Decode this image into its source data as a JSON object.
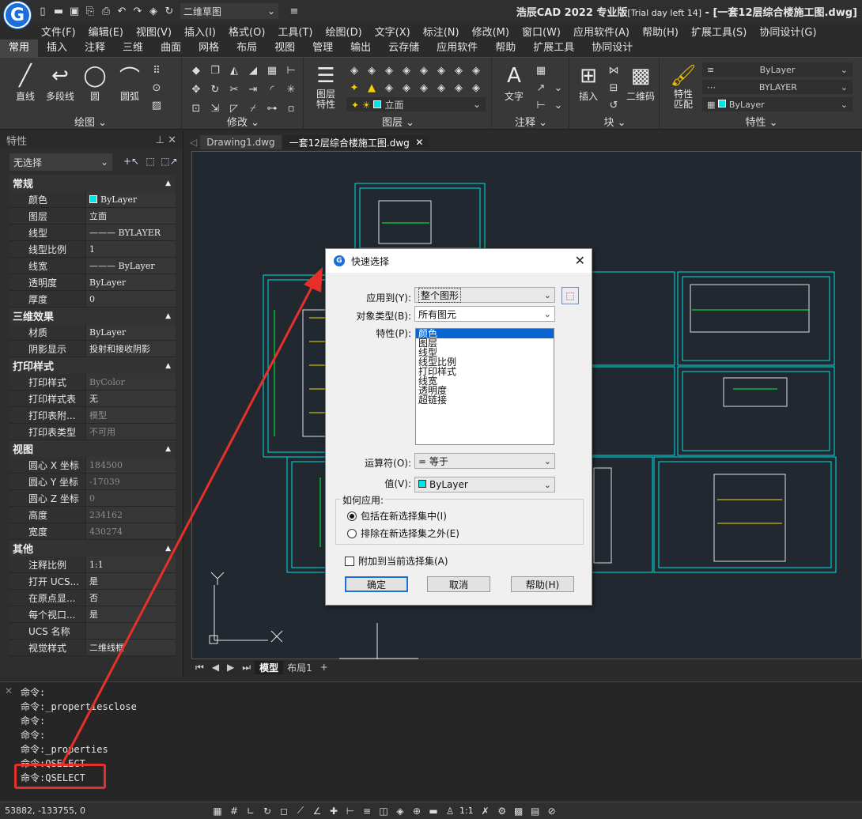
{
  "titlebar": {
    "workspace": "二维草图",
    "title_main": "浩辰CAD 2022 专业版",
    "title_trial": "[Trial day left 14]",
    "title_file": " - [一套12层综合楼施工图.dwg]"
  },
  "menu": [
    "文件(F)",
    "编辑(E)",
    "视图(V)",
    "插入(I)",
    "格式(O)",
    "工具(T)",
    "绘图(D)",
    "文字(X)",
    "标注(N)",
    "修改(M)",
    "窗口(W)",
    "应用软件(A)",
    "帮助(H)",
    "扩展工具(S)",
    "协同设计(G)"
  ],
  "ribbon_tabs": [
    "常用",
    "插入",
    "注释",
    "三维",
    "曲面",
    "网格",
    "布局",
    "视图",
    "管理",
    "输出",
    "云存储",
    "应用软件",
    "帮助",
    "扩展工具",
    "协同设计"
  ],
  "ribbon": {
    "draw": {
      "title": "绘图 ⌄",
      "line": "直线",
      "polyline": "多段线",
      "circle": "圆",
      "arc": "圆弧"
    },
    "modify": {
      "title": "修改 ⌄"
    },
    "layer": {
      "title": "图层 ⌄",
      "layer_props": "图层\n特性",
      "current_layer": "立面"
    },
    "annotate": {
      "title": "注释 ⌄",
      "text": "文字"
    },
    "block": {
      "title": "块 ⌄",
      "insert": "插入",
      "qrcode": "二维码"
    },
    "properties": {
      "title": "特性 ⌄",
      "match": "特性\n匹配",
      "bylayer1": "ByLayer",
      "bylayer2": "BYLAYER",
      "bylayer3": "ByLayer"
    }
  },
  "props_panel": {
    "header": "特性",
    "selection": "无选择",
    "sections": [
      {
        "title": "常规",
        "rows": [
          {
            "k": "颜色",
            "v": "ByLayer",
            "swatch": true
          },
          {
            "k": "图层",
            "v": "立面"
          },
          {
            "k": "线型",
            "v": "——— BYLAYER"
          },
          {
            "k": "线型比例",
            "v": "1"
          },
          {
            "k": "线宽",
            "v": "——— ByLayer"
          },
          {
            "k": "透明度",
            "v": "ByLayer"
          },
          {
            "k": "厚度",
            "v": "0"
          }
        ]
      },
      {
        "title": "三维效果",
        "rows": [
          {
            "k": "材质",
            "v": "ByLayer"
          },
          {
            "k": "阴影显示",
            "v": "投射和接收阴影"
          }
        ]
      },
      {
        "title": "打印样式",
        "rows": [
          {
            "k": "打印样式",
            "v": "ByColor",
            "gray": true
          },
          {
            "k": "打印样式表",
            "v": "无"
          },
          {
            "k": "打印表附...",
            "v": "模型",
            "gray": true
          },
          {
            "k": "打印表类型",
            "v": "不可用",
            "gray": true
          }
        ]
      },
      {
        "title": "视图",
        "rows": [
          {
            "k": "圆心 X 坐标",
            "v": "184500",
            "gray": true
          },
          {
            "k": "圆心 Y 坐标",
            "v": "-17039",
            "gray": true
          },
          {
            "k": "圆心 Z 坐标",
            "v": "0",
            "gray": true
          },
          {
            "k": "高度",
            "v": "234162",
            "gray": true
          },
          {
            "k": "宽度",
            "v": "430274",
            "gray": true
          }
        ]
      },
      {
        "title": "其他",
        "rows": [
          {
            "k": "注释比例",
            "v": "1:1"
          },
          {
            "k": "打开 UCS...",
            "v": "是"
          },
          {
            "k": "在原点显...",
            "v": "否"
          },
          {
            "k": "每个视口...",
            "v": "是"
          },
          {
            "k": "UCS 名称",
            "v": ""
          },
          {
            "k": "视觉样式",
            "v": "二维线框"
          }
        ]
      }
    ]
  },
  "doc_tabs": [
    "Drawing1.dwg",
    "一套12层综合楼施工图.dwg"
  ],
  "layout_tabs": [
    "模型",
    "布局1",
    "+"
  ],
  "command_lines": [
    "命令:",
    "命令:_propertiesclose",
    "命令:",
    "命令:",
    "命令:_properties",
    "命令:QSELECT",
    "命令:QSELECT"
  ],
  "status": {
    "coords": "53882, -133755, 0",
    "scale": "1:1"
  },
  "dialog": {
    "title": "快速选择",
    "apply_to_label": "应用到(Y):",
    "apply_to_value": "整个图形",
    "object_type_label": "对象类型(B):",
    "object_type_value": "所有图元",
    "properties_label": "特性(P):",
    "properties": [
      "颜色",
      "图层",
      "线型",
      "线型比例",
      "打印样式",
      "线宽",
      "透明度",
      "超链接"
    ],
    "operator_label": "运算符(O):",
    "operator_value": "= 等于",
    "value_label": "值(V):",
    "value_value": "ByLayer",
    "how_label": "如何应用:",
    "include": "包括在新选择集中(I)",
    "exclude": "排除在新选择集之外(E)",
    "append": "附加到当前选择集(A)",
    "ok": "确定",
    "cancel": "取消",
    "help": "帮助(H)"
  },
  "colors": {
    "accent": "#1a6fd8",
    "highlight": "#e8302a",
    "cyan": "#00e5e5"
  }
}
